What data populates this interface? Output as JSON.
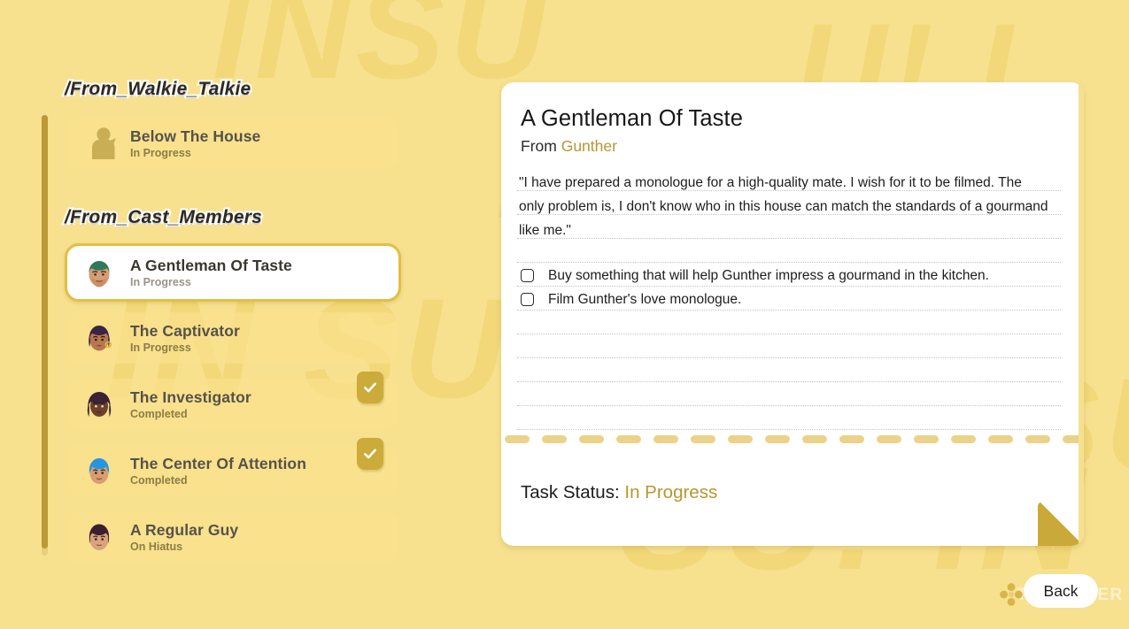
{
  "background": {
    "color": "#f7e18f",
    "watermark_letters": [
      "INSU",
      "NSU!",
      "IN SU",
      "SU! IN",
      "N SU",
      "U! I"
    ]
  },
  "sidebar": {
    "scrollbar": {
      "name": "task-list-scrollbar"
    },
    "groups": [
      {
        "title": "/From_Walkie_Talkie",
        "items": [
          {
            "name": "Below The House",
            "status": "In Progress",
            "avatar": "silhouette",
            "completed": false,
            "selected": false
          }
        ]
      },
      {
        "title": "/From_Cast_Members",
        "items": [
          {
            "name": "A Gentleman Of Taste",
            "status": "In Progress",
            "avatar": "gunther",
            "completed": false,
            "selected": true
          },
          {
            "name": "The Captivator",
            "status": "In Progress",
            "avatar": "captivator",
            "completed": false,
            "selected": false
          },
          {
            "name": "The Investigator",
            "status": "Completed",
            "avatar": "investigator",
            "completed": true,
            "selected": false
          },
          {
            "name": "The Center Of Attention",
            "status": "Completed",
            "avatar": "center-of-attention",
            "completed": true,
            "selected": false
          },
          {
            "name": "A Regular Guy",
            "status": "On Hiatus",
            "avatar": "regular-guy",
            "completed": false,
            "selected": false
          }
        ]
      }
    ]
  },
  "detail": {
    "title": "A Gentleman Of Taste",
    "from_label": "From",
    "from_name": "Gunther",
    "from_name_color": "#b79731",
    "quote": "\"I have prepared a monologue for a high-quality mate. I wish for it to be filmed. The only problem is, I don't know who in this house can match the standards of a gourmand like me.\"",
    "objectives": [
      {
        "label": "Buy something that will help Gunther impress a gourmand in the kitchen.",
        "checked": false
      },
      {
        "label": "Film Gunther's love monologue.",
        "checked": false
      }
    ],
    "status_label": "Task Status:",
    "status_value": "In Progress",
    "status_color": "#b79731"
  },
  "footer": {
    "back_label": "Back",
    "clover_icon": "clover-icon",
    "watermark": "THEGAMER"
  }
}
